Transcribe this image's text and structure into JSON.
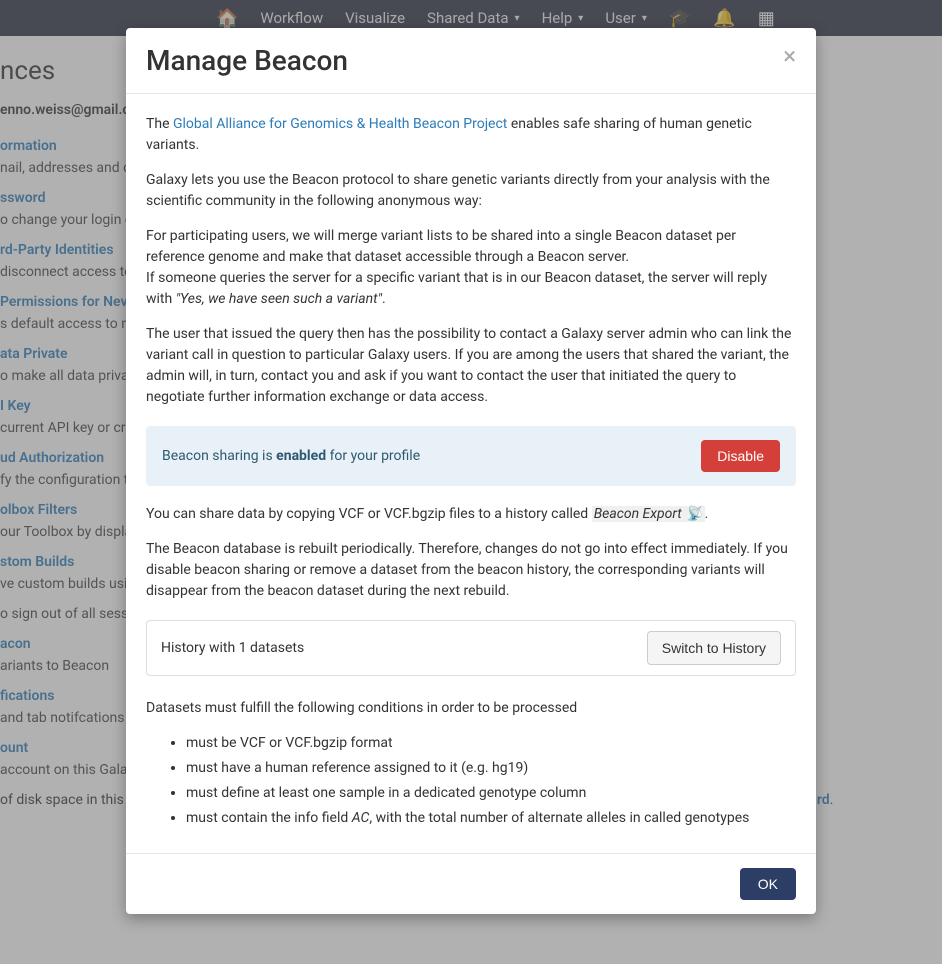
{
  "navbar": {
    "items": [
      "Workflow",
      "Visualize",
      "Shared Data",
      "Help",
      "User"
    ]
  },
  "background": {
    "heading": "nces",
    "email": "enno.weiss@gmail.c",
    "sections": [
      {
        "title": "ormation",
        "desc": "nail, addresses and cu"
      },
      {
        "title": "ssword",
        "desc": "o change your login cr"
      },
      {
        "title": "rd-Party Identities",
        "desc": "disconnect access to y"
      },
      {
        "title": " Permissions for Nev",
        "desc": "s default access to new"
      },
      {
        "title": "ata Private",
        "desc": "o make all data private"
      },
      {
        "title": "I Key",
        "desc": " current API key or cre"
      },
      {
        "title": "ud Authorization",
        "desc": "fy the configuration th"
      },
      {
        "title": "stom Builds",
        "desc": "ve custom builds usin"
      },
      {
        "title": "olbox Filters",
        "desc": "our Toolbox by displa"
      },
      {
        "title": "",
        "desc": "o sign out of all sessio"
      },
      {
        "title": "acon",
        "desc": "ariants to Beacon"
      },
      {
        "title": "fications",
        "desc": "and tab notifcations or"
      },
      {
        "title": "ount",
        "desc": "account on this Galax"
      }
    ],
    "disk_prefix": " of disk space in this G",
    "disk_link": "rd"
  },
  "modal": {
    "title": "Manage Beacon",
    "close": "×",
    "intro_prefix": "The ",
    "intro_link": "Global Alliance for Genomics & Health Beacon Project",
    "intro_suffix": " enables safe sharing of human genetic variants.",
    "p2": "Galaxy lets you use the Beacon protocol to share genetic variants directly from your analysis with the scientific community in the following anonymous way:",
    "p3a": "For participating users, we will merge variant lists to be shared into a single Beacon dataset per reference genome and make that dataset accessible through a Beacon server.",
    "p3b_prefix": "If someone queries the server for a specific variant that is in our Beacon dataset, the server will reply with ",
    "p3b_italic": "\"Yes, we have seen such a variant\"",
    "p3b_suffix": ".",
    "p4": "The user that issued the query then has the possibility to contact a Galaxy server admin who can link the variant call in question to particular Galaxy users. If you are among the users that shared the variant, the admin will, in turn, contact you and ask if you want to contact the user that initiated the query to negotiate further information exchange or data access.",
    "status_prefix": "Beacon sharing is ",
    "status_bold": "enabled",
    "status_suffix": " for your profile",
    "disable_button": "Disable",
    "share_prefix": "You can share data by copying VCF or VCF.bgzip files to a history called ",
    "share_hist": "Beacon Export 📡",
    "share_suffix": ".",
    "rebuild": "The Beacon database is rebuilt periodically. Therefore, changes do not go into effect immediately. If you disable beacon sharing or remove a dataset from the beacon history, the corresponding variants will disappear from the beacon dataset during the next rebuild.",
    "history_label": "History with 1 datasets",
    "switch_button": "Switch to History",
    "conditions_intro": "Datasets must fulfill the following conditions in order to be processed",
    "conditions": [
      "must be VCF or VCF.bgzip format",
      "must have a human reference assigned to it (e.g. hg19)",
      "must define at least one sample in a dedicated genotype column"
    ],
    "cond4_prefix": "must contain the info field ",
    "cond4_italic": "AC",
    "cond4_suffix": ", with the total number of alternate alleles in called genotypes",
    "ok_button": "OK"
  }
}
